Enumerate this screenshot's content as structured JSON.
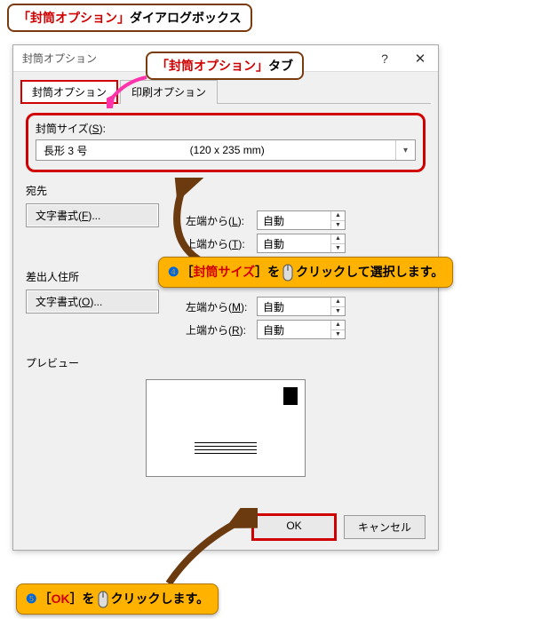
{
  "annotations": {
    "top": {
      "quoted": "「封筒オプション」",
      "suffix": "ダイアログボックス"
    },
    "tab_callout": {
      "quoted": "「封筒オプション」",
      "suffix": "タブ"
    },
    "step4": {
      "num": "❹",
      "part1": "［",
      "red": "封筒サイズ",
      "part2": "］を",
      "action": "クリック",
      "part3": "して選択します。"
    },
    "step5": {
      "num": "❺",
      "part1": "［",
      "red": "OK",
      "part2": "］を",
      "action": "クリック",
      "part3": "します。"
    }
  },
  "dialog": {
    "title": "封筒オプション",
    "help": "?",
    "close": "✕",
    "tabs": {
      "envelope": "封筒オプション",
      "print": "印刷オプション"
    },
    "size": {
      "label_pre": "封筒サイズ(",
      "label_key": "S",
      "label_post": "):",
      "value": "長形 3 号",
      "dimensions": "(120 x 235 mm)"
    },
    "recipient": {
      "heading": "宛先",
      "font_btn_pre": "文字書式(",
      "font_btn_key": "F",
      "font_btn_post": ")...",
      "left_label_pre": "左端から(",
      "left_label_key": "L",
      "left_label_post": "):",
      "left_value": "自動",
      "top_label_pre": "上端から(",
      "top_label_key": "T",
      "top_label_post": "):",
      "top_value": "自動"
    },
    "sender": {
      "heading": "差出人住所",
      "font_btn_pre": "文字書式(",
      "font_btn_key": "O",
      "font_btn_post": ")...",
      "left_label_pre": "左端から(",
      "left_label_key": "M",
      "left_label_post": "):",
      "left_value": "自動",
      "top_label_pre": "上端から(",
      "top_label_key": "R",
      "top_label_post": "):",
      "top_value": "自動"
    },
    "preview": {
      "heading": "プレビュー"
    },
    "buttons": {
      "ok": "OK",
      "cancel": "キャンセル"
    }
  }
}
